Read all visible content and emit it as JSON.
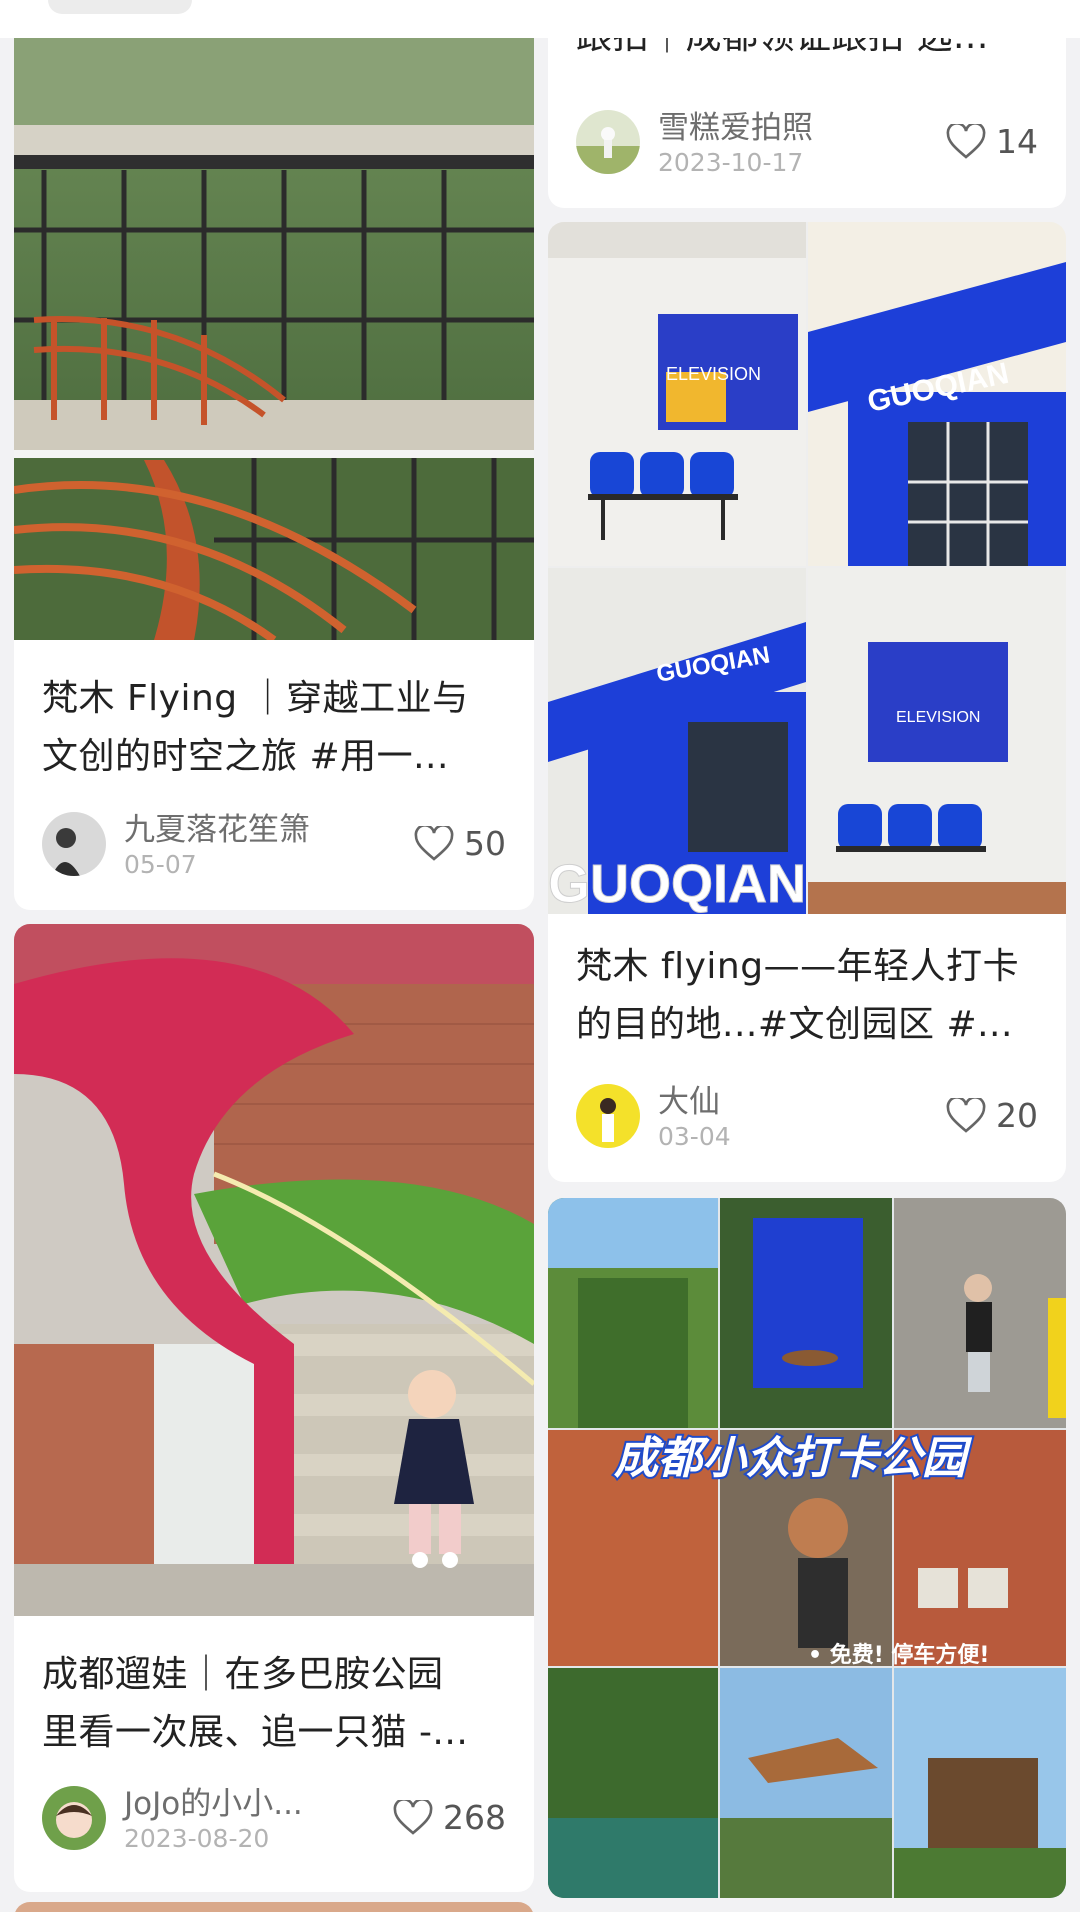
{
  "feed": {
    "cards": [
      {
        "title_lines": [
          "梵木 Flying ｜穿越工业与",
          "文创的时空之旅 #用一..."
        ],
        "author": "九夏落花笙箫",
        "date": "05-07",
        "likes": "50",
        "image_subject": "glass-building-orange-spiral-stairs"
      },
      {
        "title_lines": [
          "跟拍｜成都领证跟拍 选..."
        ],
        "author": "雪糕爱拍照",
        "date": "2023-10-17",
        "likes": "14",
        "image_subject": "cropped"
      },
      {
        "title_lines": [
          "梵木 flying——年轻人打卡",
          "的目的地...#文创园区 #..."
        ],
        "author": "大仙",
        "date": "03-04",
        "likes": "20",
        "image_subject": "blue-storefront-collage",
        "image_text": [
          "ELEVISION",
          "GUOQIAN",
          "GUOQIAN",
          "ELEVISION",
          "GUOQIAN"
        ]
      },
      {
        "title_lines": [
          "成都遛娃｜在多巴胺公园",
          "里看一次展、追一只猫 -..."
        ],
        "author": "JoJo的小小...",
        "date": "2023-08-20",
        "likes": "268",
        "image_subject": "pink-green-spiral-staircase-child"
      },
      {
        "title_lines": [],
        "image_subject": "park-collage",
        "image_text": [
          "成都小众打卡公园",
          "• 免费! 停车方便!"
        ]
      }
    ]
  },
  "colors": {
    "background": "#f2f2f4",
    "card": "#ffffff",
    "title": "#222222",
    "meta": "#6e6e6e",
    "date": "#b3b3b3",
    "brand_blue": "#1d3fd8"
  }
}
